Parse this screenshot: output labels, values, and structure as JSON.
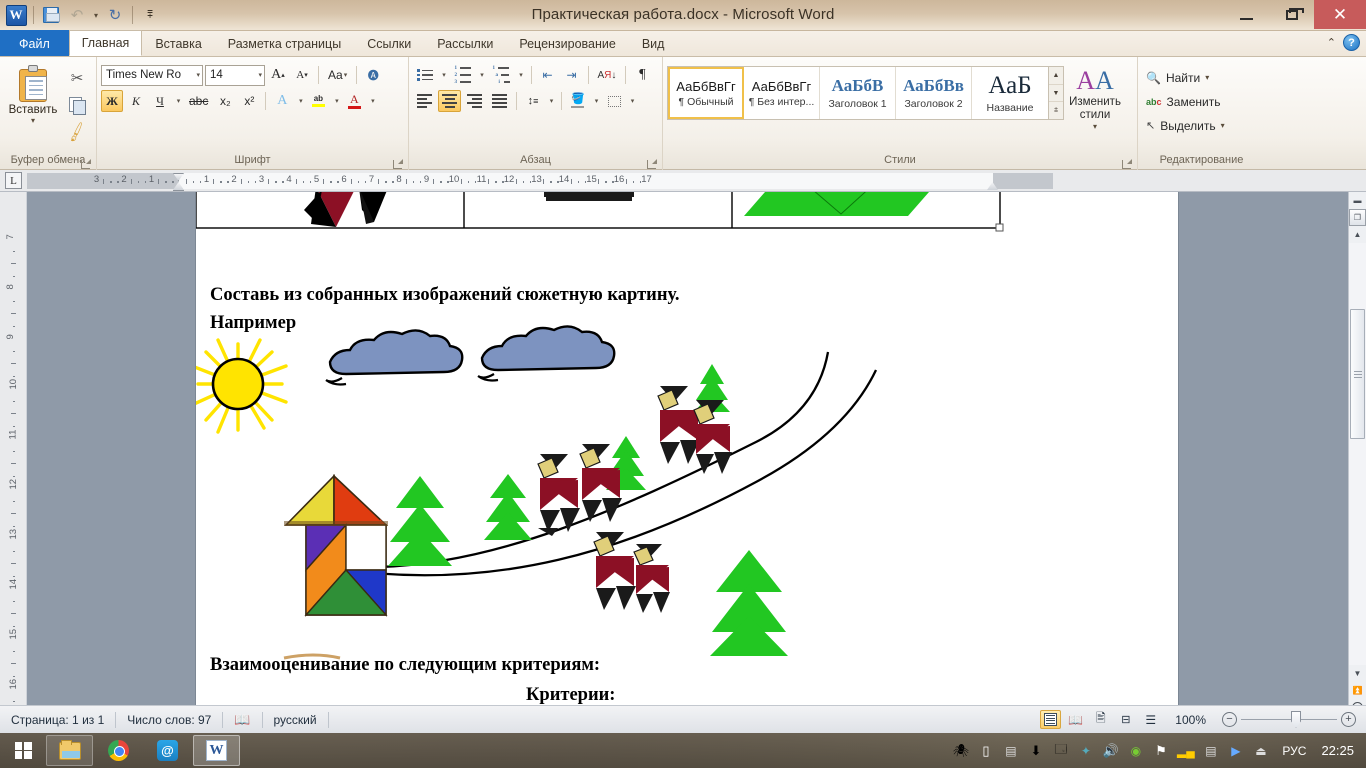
{
  "titlebar": {
    "app_icon": "word-logo-icon",
    "document_title": "Практическая работа.docx  -  Microsoft Word",
    "quick_access": [
      {
        "name": "save-icon",
        "label": "Сохранить"
      },
      {
        "name": "undo-icon",
        "label": "Отменить"
      },
      {
        "name": "redo-icon",
        "label": "Вернуть"
      },
      {
        "name": "customize-qat-icon",
        "label": "Настройка панели быстрого доступа"
      }
    ],
    "window_controls": [
      {
        "name": "minimize-button",
        "glyph": "—"
      },
      {
        "name": "maximize-button",
        "glyph": "❐"
      },
      {
        "name": "close-button",
        "glyph": "✕"
      }
    ]
  },
  "ribbon": {
    "tabs": [
      {
        "label": "Файл",
        "kind": "file"
      },
      {
        "label": "Главная",
        "kind": "active"
      },
      {
        "label": "Вставка",
        "kind": "normal"
      },
      {
        "label": "Разметка страницы",
        "kind": "normal"
      },
      {
        "label": "Ссылки",
        "kind": "normal"
      },
      {
        "label": "Рассылки",
        "kind": "normal"
      },
      {
        "label": "Рецензирование",
        "kind": "normal"
      },
      {
        "label": "Вид",
        "kind": "normal"
      }
    ],
    "collapse_label": "⌃",
    "help_label": "?",
    "groups": {
      "clipboard": {
        "title": "Буфер обмена",
        "paste_label": "Вставить",
        "buttons": [
          {
            "name": "cut-button",
            "label": "Вырезать"
          },
          {
            "name": "copy-button",
            "label": "Копировать"
          },
          {
            "name": "format-painter-button",
            "label": "Формат по образцу"
          }
        ]
      },
      "font": {
        "title": "Шрифт",
        "font_name": "Times New Ro",
        "font_size": "14",
        "grow_label": "A",
        "shrink_label": "A",
        "change_case_label": "Aa",
        "clear_format_label": "Aa",
        "bold_label": "Ж",
        "italic_label": "К",
        "underline_label": "Ч",
        "strike_label": "abc",
        "sub_label": "x₂",
        "sup_label": "x²",
        "text_effects_label": "A",
        "highlight_label": "ab",
        "font_color_label": "A",
        "font_color": "#d41717",
        "highlight_color": "#ffff00"
      },
      "paragraph": {
        "title": "Абзац",
        "buttons": [
          {
            "name": "bullets-button",
            "label": "Маркеры"
          },
          {
            "name": "numbering-button",
            "label": "Нумерация"
          },
          {
            "name": "multilevel-list-button",
            "label": "Многоуровневый список"
          },
          {
            "name": "decrease-indent-button",
            "label": "Уменьшить отступ"
          },
          {
            "name": "increase-indent-button",
            "label": "Увеличить отступ"
          },
          {
            "name": "sort-button",
            "label": "Сортировка"
          },
          {
            "name": "show-marks-button",
            "label": "¶"
          },
          {
            "name": "align-left-button",
            "label": "По левому краю"
          },
          {
            "name": "align-center-button",
            "label": "По центру"
          },
          {
            "name": "align-right-button",
            "label": "По правому краю"
          },
          {
            "name": "justify-button",
            "label": "По ширине"
          },
          {
            "name": "line-spacing-button",
            "label": "Интервал"
          },
          {
            "name": "shading-button",
            "label": "Заливка"
          },
          {
            "name": "borders-button",
            "label": "Границы"
          }
        ]
      },
      "styles": {
        "title": "Стили",
        "gallery": [
          {
            "preview": "АаБбВвГг",
            "name": "¶ Обычный",
            "selected": true
          },
          {
            "preview": "АаБбВвГг",
            "name": "¶ Без интер...",
            "selected": false
          },
          {
            "preview": "АаБбВ",
            "name": "Заголовок 1",
            "selected": false
          },
          {
            "preview": "АаБбВв",
            "name": "Заголовок 2",
            "selected": false
          },
          {
            "preview": "АаБ",
            "name": "Название",
            "selected": false
          }
        ],
        "change_styles_label": "Изменить стили"
      },
      "editing": {
        "title": "Редактирование",
        "items": [
          {
            "name": "find-item",
            "label": "Найти",
            "icon": "binoculars-icon"
          },
          {
            "name": "replace-item",
            "label": "Заменить",
            "icon": "replace-icon"
          },
          {
            "name": "select-item",
            "label": "Выделить",
            "icon": "cursor-icon"
          }
        ]
      }
    }
  },
  "ruler": {
    "tab_stop_glyph": "L",
    "horizontal_left": [
      "3",
      "2",
      "1"
    ],
    "horizontal_right": [
      "1",
      "2",
      "3",
      "4",
      "5",
      "6",
      "7",
      "8",
      "9",
      "10",
      "11",
      "12",
      "13",
      "14",
      "15",
      "16",
      "17"
    ],
    "vertical": [
      "7",
      "8",
      "9",
      "10",
      "11",
      "12",
      "13",
      "14",
      "15",
      "16"
    ]
  },
  "document": {
    "paragraphs": [
      {
        "id": "p1",
        "text": "Составь из собранных изображений сюжетную картину.",
        "align": "left"
      },
      {
        "id": "p2",
        "text": "Например",
        "align": "left"
      },
      {
        "id": "p3",
        "text": "Взаимооценивание по следующим критериям:",
        "align": "left"
      },
      {
        "id": "p4",
        "text": "Критерии:",
        "align": "center"
      }
    ],
    "illustration": {
      "name": "tangram-scene-illustration",
      "sun_color": "#ffe400",
      "cloud_color": "#7d93c0",
      "tree_color": "#22c722",
      "figure_color": "#8c1025",
      "house_colors": [
        "#e8d939",
        "#e03c10",
        "#5b2fb5",
        "#f28b1b",
        "#ffffff",
        "#1f38c9",
        "#2f8f37"
      ]
    }
  },
  "statusbar": {
    "page_label": "Страница: 1 из 1",
    "words_label": "Число слов: 97",
    "proofing_icon": "spellcheck-icon",
    "language_label": "русский",
    "views": [
      {
        "name": "print-layout-view-button",
        "active": true
      },
      {
        "name": "full-screen-reading-view-button",
        "active": false
      },
      {
        "name": "web-layout-view-button",
        "active": false
      },
      {
        "name": "outline-view-button",
        "active": false
      },
      {
        "name": "draft-view-button",
        "active": false
      }
    ],
    "zoom_label": "100%",
    "zoom_out_label": "−",
    "zoom_in_label": "+"
  },
  "taskbar": {
    "start_label": "Пуск",
    "buttons": [
      {
        "name": "taskbar-explorer",
        "icon": "folder-icon",
        "state": "run"
      },
      {
        "name": "taskbar-chrome",
        "icon": "chrome-icon",
        "state": "idle"
      },
      {
        "name": "taskbar-mail",
        "icon": "mail-icon",
        "state": "idle"
      },
      {
        "name": "taskbar-word",
        "icon": "word-icon",
        "state": "active"
      }
    ],
    "tray": [
      {
        "name": "tray-antivirus-icon"
      },
      {
        "name": "tray-battery-icon"
      },
      {
        "name": "tray-display-icon"
      },
      {
        "name": "tray-download-icon"
      },
      {
        "name": "tray-app-icon"
      },
      {
        "name": "tray-bluetooth-icon"
      },
      {
        "name": "tray-volume-icon"
      },
      {
        "name": "tray-nvidia-icon"
      },
      {
        "name": "tray-flag-icon"
      },
      {
        "name": "tray-network-icon"
      },
      {
        "name": "tray-keyboard-icon"
      },
      {
        "name": "tray-media-icon"
      },
      {
        "name": "tray-eject-icon"
      }
    ],
    "language": "РУС",
    "clock": "22:25"
  }
}
